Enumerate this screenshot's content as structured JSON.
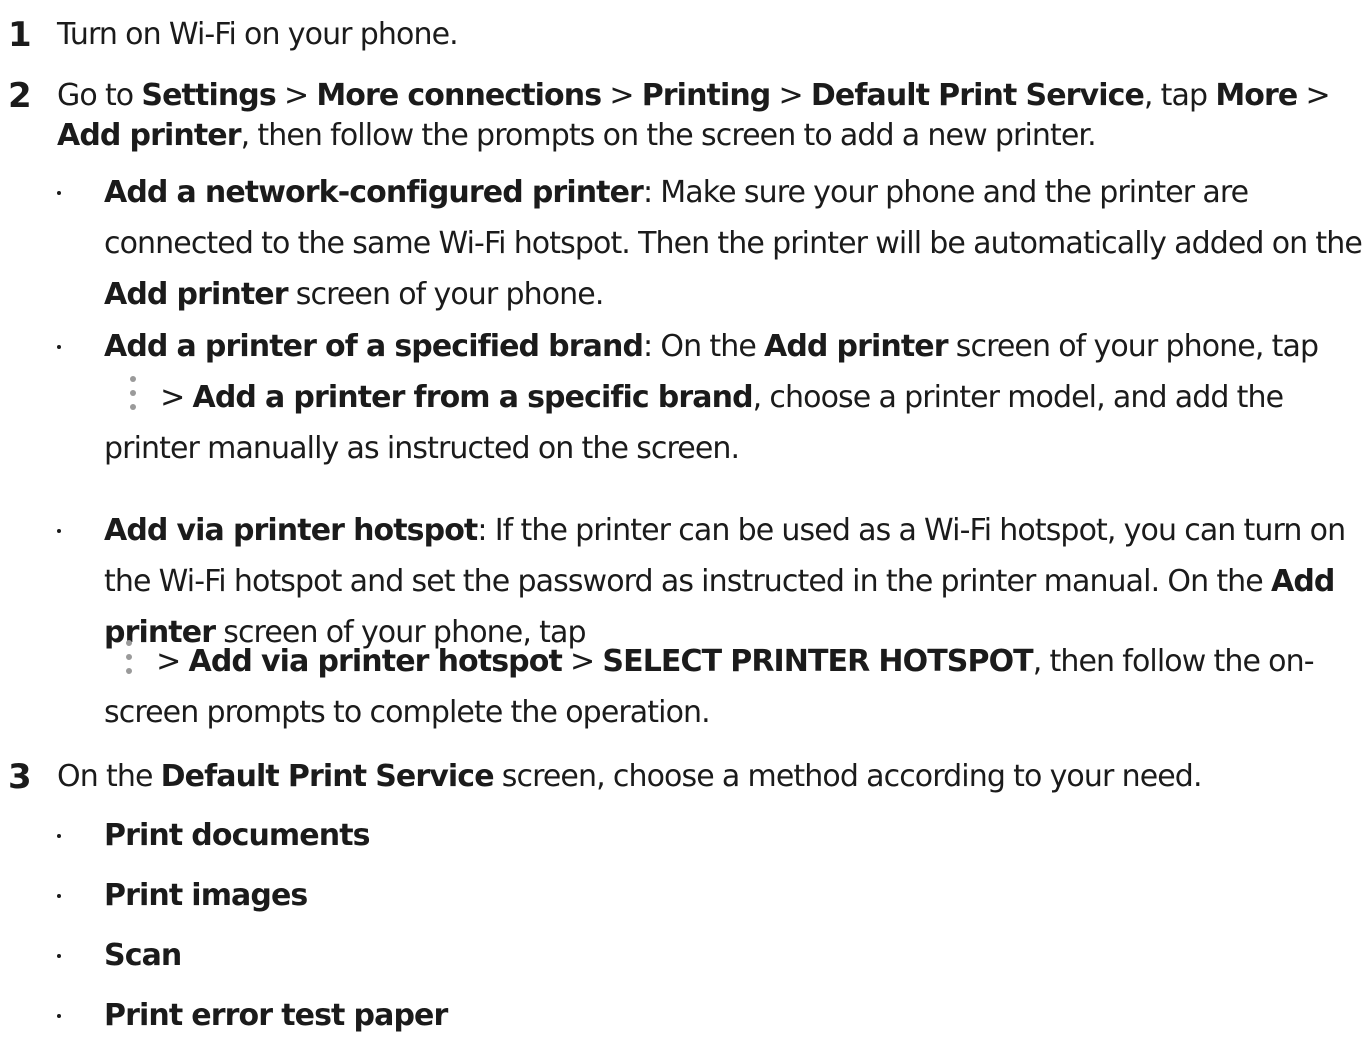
{
  "steps": [
    {
      "number": "1",
      "text": "Turn on Wi-Fi on your phone."
    },
    {
      "number": "2",
      "parts": [
        "Go to ",
        "Settings",
        " > ",
        "More connections",
        " > ",
        "Printing",
        " > ",
        "Default Print Service",
        ", tap ",
        "More",
        " > ",
        "Add printer",
        ", then follow the prompts on the screen to add a new printer."
      ],
      "bullets": [
        {
          "title": "Add a network-configured printer",
          "p1": ": Make sure your phone and the printer are connected to the same Wi-Fi hotspot. Then the printer will be automatically added on the ",
          "b1": "Add printer",
          "p2": " screen of your phone."
        },
        {
          "title": "Add a printer of a specified brand",
          "p1": ": On the ",
          "b1": "Add printer",
          "p2": " screen of your phone, tap",
          "icon": "more-vertical-icon",
          "p3": " > ",
          "b2": "Add a printer from a specific brand",
          "p4": ", choose a printer model, and add the printer manually as instructed on the screen."
        },
        {
          "title": "Add via printer hotspot",
          "p1": ": If the printer can be used as a Wi-Fi hotspot, you can turn on the Wi-Fi hotspot and set the password as instructed in the printer manual. On the ",
          "b1": "Add printer",
          "p2": " screen of your phone, tap",
          "icon": "more-vertical-icon",
          "p3": " > ",
          "b2": "Add via printer hotspot",
          "p4": " > ",
          "b3": "SELECT PRINTER HOTSPOT",
          "p5": ", then follow the on-screen prompts to complete the operation."
        }
      ]
    },
    {
      "number": "3",
      "p1": "On the ",
      "b1": "Default Print Service",
      "p2": " screen, choose a method according to your need.",
      "bullets": [
        "Print documents",
        "Print images",
        "Scan",
        "Print error test paper"
      ]
    }
  ]
}
